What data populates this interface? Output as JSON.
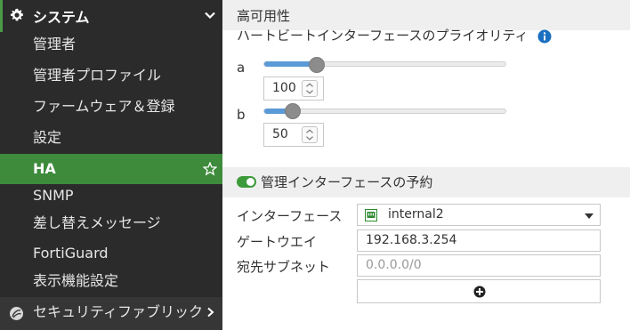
{
  "sidebar": {
    "header": {
      "label": "システム",
      "icon": "gear-icon"
    },
    "items": [
      {
        "label": "管理者"
      },
      {
        "label": "管理者プロファイル"
      },
      {
        "label": "ファームウェア＆登録"
      },
      {
        "label": "設定"
      },
      {
        "label": "HA",
        "active": true
      },
      {
        "label": "SNMP"
      },
      {
        "label": "差し替えメッセージ"
      },
      {
        "label": "FortiGuard"
      },
      {
        "label": "表示機能設定"
      }
    ],
    "bottom": {
      "label": "セキュリティファブリック",
      "icon": "fabric-icon"
    }
  },
  "main": {
    "section_title": "高可用性",
    "priority": {
      "title": "ハートビートインターフェースのプライオリティ",
      "rows": [
        {
          "label": "a",
          "value": "100",
          "fill_fraction": 0.22
        },
        {
          "label": "b",
          "value": "50",
          "fill_fraction": 0.12
        }
      ]
    },
    "mgmt": {
      "toggle_label": "管理インターフェースの予約",
      "toggle_on": true,
      "interface_label": "インターフェース",
      "interface_value": "internal2",
      "gateway_label": "ゲートウエイ",
      "gateway_value": "192.168.3.254",
      "subnet_label": "宛先サブネット",
      "subnet_placeholder": "0.0.0.0/0"
    }
  },
  "colors": {
    "sidebar_bg": "#2b2b2b",
    "active_bg": "#3d8b3b",
    "slider_fill": "#5a9ad6",
    "toggle_on": "#3c9a3a",
    "info": "#1a6fc0"
  }
}
